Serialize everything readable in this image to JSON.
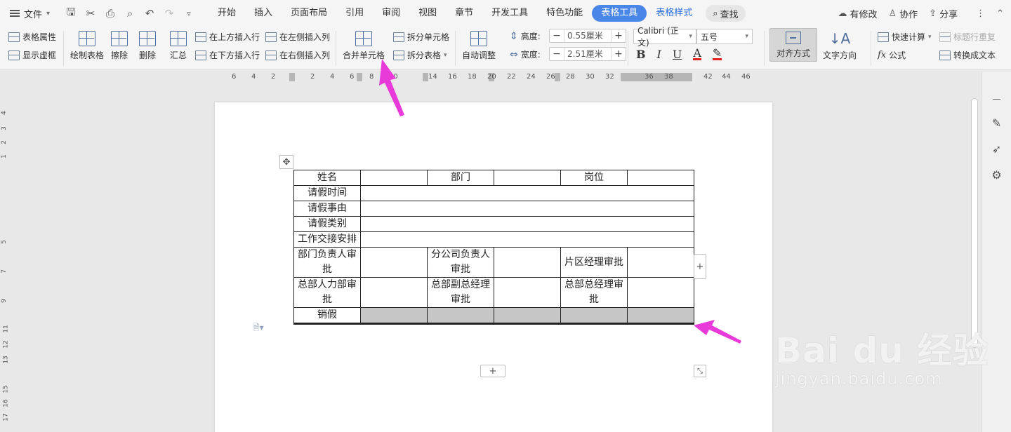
{
  "menubar": {
    "file": "文件",
    "tabs": [
      "开始",
      "插入",
      "页面布局",
      "引用",
      "审阅",
      "视图",
      "章节",
      "开发工具",
      "特色功能"
    ],
    "active_tab": "表格工具",
    "style_tab": "表格样式",
    "search": "查找",
    "modified": "有修改",
    "collab": "协作",
    "share": "分享"
  },
  "ribbon": {
    "table_props": "表格属性",
    "show_grid": "显示虚框",
    "draw_table": "绘制表格",
    "erase": "擦除",
    "delete": "删除",
    "summary": "汇总",
    "insert_above": "在上方插入行",
    "insert_below": "在下方插入行",
    "insert_left": "在左侧插入列",
    "insert_right": "在右侧插入列",
    "merge_cells": "合并单元格",
    "split_cells": "拆分单元格",
    "split_table": "拆分表格",
    "auto_adjust": "自动调整",
    "height_label": "高度:",
    "height_value": "0.55厘米",
    "width_label": "宽度:",
    "width_value": "2.51厘米",
    "font_name": "Calibri (正文)",
    "font_size": "五号",
    "align": "对齐方式",
    "text_dir": "文字方向",
    "quick_calc": "快速计算",
    "repeat_header": "标题行重复",
    "formula": "公式",
    "to_text": "转换成文本"
  },
  "ruler": {
    "numbers": [
      "6",
      "4",
      "2",
      "2",
      "4",
      "6",
      "8",
      "10",
      "14",
      "16",
      "18",
      "20",
      "22",
      "24",
      "26",
      "28",
      "30",
      "32",
      "36",
      "38",
      "42",
      "44",
      "46"
    ]
  },
  "vruler": {
    "numbers": [
      "4",
      "3",
      "2",
      "1",
      "5",
      "7",
      "9",
      "11",
      "12",
      "13",
      "15",
      "16",
      "17"
    ]
  },
  "table": {
    "r1": [
      "姓名",
      "",
      "部门",
      "",
      "岗位",
      ""
    ],
    "r2": "请假时间",
    "r3": "请假事由",
    "r4": "请假类别",
    "r5": "工作交接安排",
    "r6": [
      "部门负责人审批",
      "",
      "分公司负责人审批",
      "",
      "片区经理审批",
      ""
    ],
    "r7": [
      "总部人力部审批",
      "",
      "总部副总经理审批",
      "",
      "总部总经理审批",
      ""
    ],
    "r8": "销假"
  },
  "watermark": {
    "logo": "Bai du 经验",
    "url": "jingyan.baidu.com"
  },
  "colors": {
    "accent": "#4a86e8",
    "arrow": "#e83ad8",
    "selection": "#c6c6c6"
  }
}
